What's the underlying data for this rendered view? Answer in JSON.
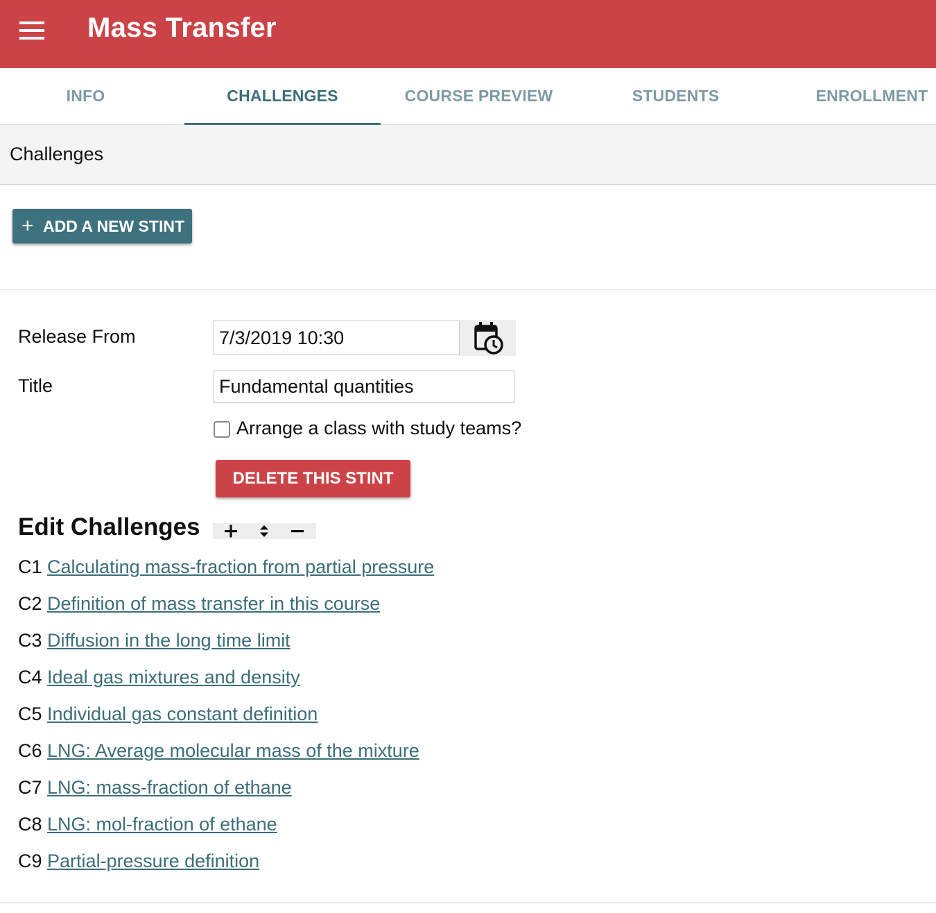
{
  "appbar": {
    "title": "Mass Transfer",
    "color": "#cc4347"
  },
  "tabs": [
    {
      "label": "INFO"
    },
    {
      "label": "CHALLENGES"
    },
    {
      "label": "COURSE PREVIEW"
    },
    {
      "label": "STUDENTS"
    },
    {
      "label": "ENROLLMENT"
    }
  ],
  "active_tab": "CHALLENGES",
  "section": {
    "title": "Challenges"
  },
  "actions": {
    "add_stint": "ADD A NEW STINT",
    "add_icon": "plus-icon",
    "delete_stint": "DELETE THIS STINT"
  },
  "stint": {
    "release_label": "Release From",
    "release_value": "7/3/2019 10:30",
    "release_picker_icon": "calendar-clock-icon",
    "title_label": "Title",
    "title_value": "Fundamental quantities",
    "study_teams_label": "Arrange a class with study teams?",
    "study_teams_checked": false
  },
  "edit": {
    "title": "Edit Challenges",
    "tools": [
      "plus-icon",
      "sort-icon",
      "minus-icon"
    ]
  },
  "challenges": [
    {
      "code": "C1",
      "title": "Calculating mass-fraction from partial pressure"
    },
    {
      "code": "C2",
      "title": "Definition of mass transfer in this course"
    },
    {
      "code": "C3",
      "title": "Diffusion in the long time limit"
    },
    {
      "code": "C4",
      "title": "Ideal gas mixtures and density"
    },
    {
      "code": "C5",
      "title": "Individual gas constant definition"
    },
    {
      "code": "C6",
      "title": "LNG: Average molecular mass of the mixture"
    },
    {
      "code": "C7",
      "title": "LNG: mass-fraction of ethane"
    },
    {
      "code": "C8",
      "title": "LNG: mol-fraction of ethane"
    },
    {
      "code": "C9",
      "title": "Partial-pressure definition"
    }
  ],
  "colors": {
    "primary": "#3d717d",
    "danger": "#cc4347",
    "link": "#3c6e78",
    "tab_inactive": "#7d9ba3"
  }
}
